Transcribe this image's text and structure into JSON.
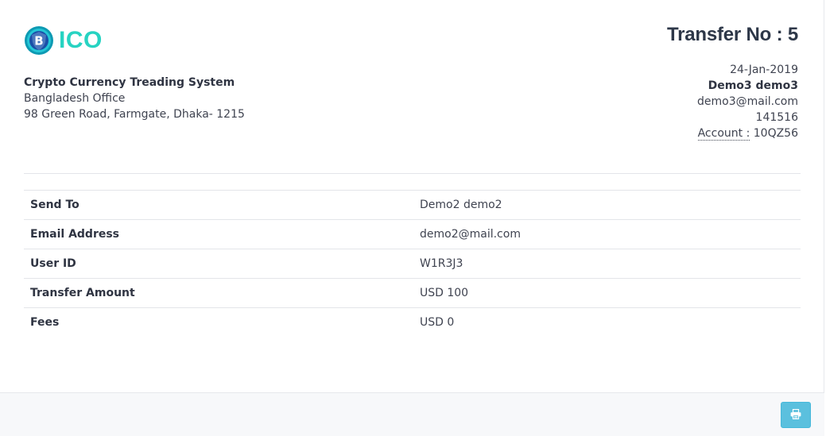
{
  "brand": {
    "logo_text": "ICO",
    "logo_icon": "bitcoin-shield-icon",
    "accent": "#27d3c2"
  },
  "company": {
    "name": "Crypto Currency Treading System",
    "office": "Bangladesh Office",
    "address": "98 Green Road, Farmgate, Dhaka- 1215"
  },
  "transfer": {
    "title": "Transfer No : 5",
    "date": "24-Jan-2019",
    "sender_name": "Demo3 demo3",
    "sender_email": "demo3@mail.com",
    "sender_id": "141516",
    "account_label": "Account :",
    "account_value": "10QZ56"
  },
  "details": [
    {
      "label": "Send To",
      "value": "Demo2 demo2"
    },
    {
      "label": "Email Address",
      "value": "demo2@mail.com"
    },
    {
      "label": "User ID",
      "value": "W1R3J3"
    },
    {
      "label": "Transfer Amount",
      "value": "USD 100"
    },
    {
      "label": "Fees",
      "value": "USD 0"
    }
  ],
  "footer": {
    "print_icon": "printer-icon",
    "button_color": "#5bc0de"
  }
}
